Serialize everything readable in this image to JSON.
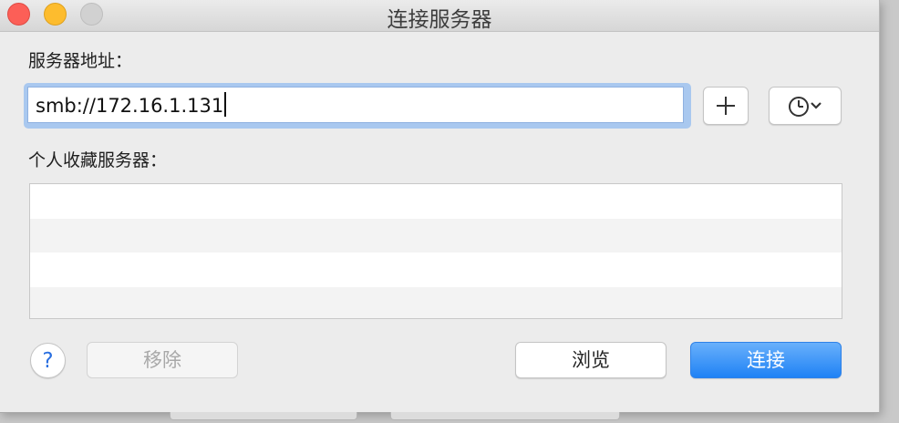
{
  "window": {
    "title": "连接服务器",
    "colors": {
      "close": "#fc5f57",
      "minimize": "#fdbc2e",
      "zoom": "#d1d1d1"
    }
  },
  "server_address": {
    "label": "服务器地址：",
    "value": "smb://172.16.1.131",
    "add_icon": "plus-icon",
    "history_icon": "clock-icon",
    "history_chevron_icon": "chevron-down-icon"
  },
  "favorites": {
    "label": "个人收藏服务器：",
    "items": []
  },
  "buttons": {
    "help": "?",
    "remove": "移除",
    "browse": "浏览",
    "connect": "连接",
    "accent": "#1f82f5"
  }
}
